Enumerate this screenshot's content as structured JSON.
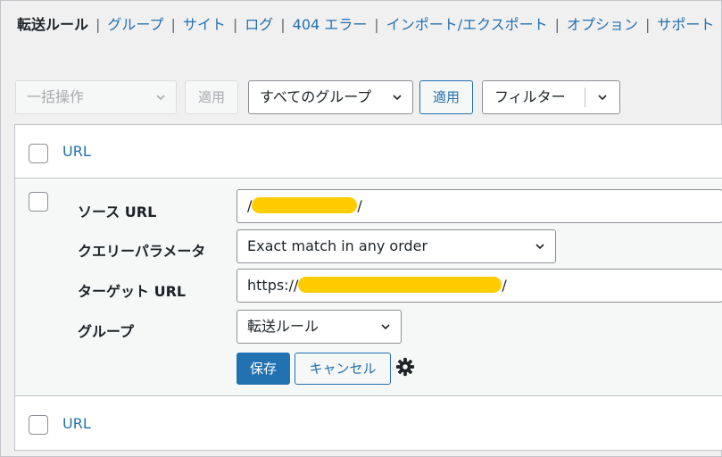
{
  "nav": {
    "current": "転送ルール",
    "items": [
      "グループ",
      "サイト",
      "ログ",
      "404 エラー",
      "インポート/エクスポート",
      "オプション",
      "サポート"
    ],
    "separator": "|"
  },
  "toolbar": {
    "bulk_action": "一括操作",
    "apply_disabled": "適用",
    "group_select": "すべてのグループ",
    "apply": "適用",
    "filter": "フィルター"
  },
  "table": {
    "header_column": "URL",
    "footer_column": "URL"
  },
  "edit": {
    "source_label": "ソース URL",
    "source_prefix": "/",
    "source_suffix": "/",
    "query_label": "クエリーパラメータ",
    "query_value": "Exact match in any order",
    "target_label": "ターゲット URL",
    "target_prefix": "https://",
    "target_suffix": "/",
    "group_label": "グループ",
    "group_value": "転送ルール",
    "save": "保存",
    "cancel": "キャンセル"
  },
  "colors": {
    "link": "#2271b1",
    "primary": "#2271b1",
    "redaction": "#ffcc00"
  }
}
